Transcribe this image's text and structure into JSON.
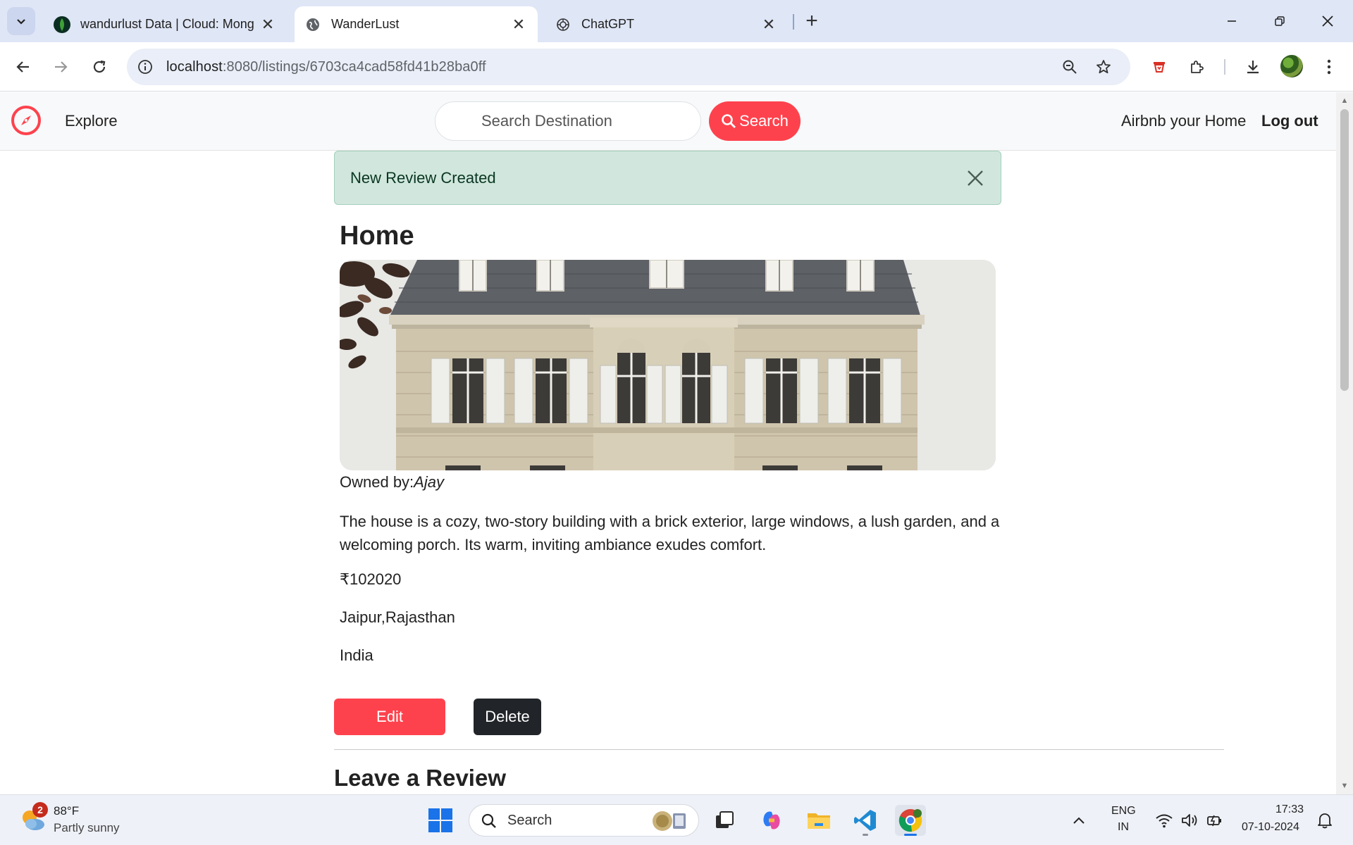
{
  "browser": {
    "tabs": [
      {
        "title": "wandurlust Data | Cloud: Mong",
        "favicon": "mongodb-leaf-icon",
        "active": false
      },
      {
        "title": "WanderLust",
        "favicon": "globe-icon",
        "active": true
      },
      {
        "title": "ChatGPT",
        "favicon": "openai-icon",
        "active": false
      }
    ],
    "url_host": "localhost",
    "url_path": ":8080/listings/6703ca4cad58fd41b28ba0ff"
  },
  "navbar": {
    "explore": "Explore",
    "search_placeholder": "Search Destination",
    "search_button": "Search",
    "airbnb_home": "Airbnb your Home",
    "logout": "Log out"
  },
  "flash": {
    "message": "New Review Created"
  },
  "listing": {
    "title": "Home",
    "owner_label": "Owned by:",
    "owner": "Ajay",
    "description": "The house is a cozy, two-story building with a brick exterior, large windows, a lush garden, and a welcoming porch. Its warm, inviting ambiance exudes comfort.",
    "price": "₹102020",
    "location": "Jaipur,Rajasthan",
    "country": "India",
    "edit_label": "Edit",
    "delete_label": "Delete"
  },
  "review": {
    "heading": "Leave a Review"
  },
  "taskbar": {
    "weather_badge": "2",
    "weather_temp": "88°F",
    "weather_desc": "Partly sunny",
    "search_label": "Search",
    "lang_top": "ENG",
    "lang_bottom": "IN",
    "time": "17:33",
    "date": "07-10-2024"
  },
  "colors": {
    "brand": "#fe424d",
    "dark_button": "#212529",
    "alert_bg": "#d1e7dd"
  }
}
